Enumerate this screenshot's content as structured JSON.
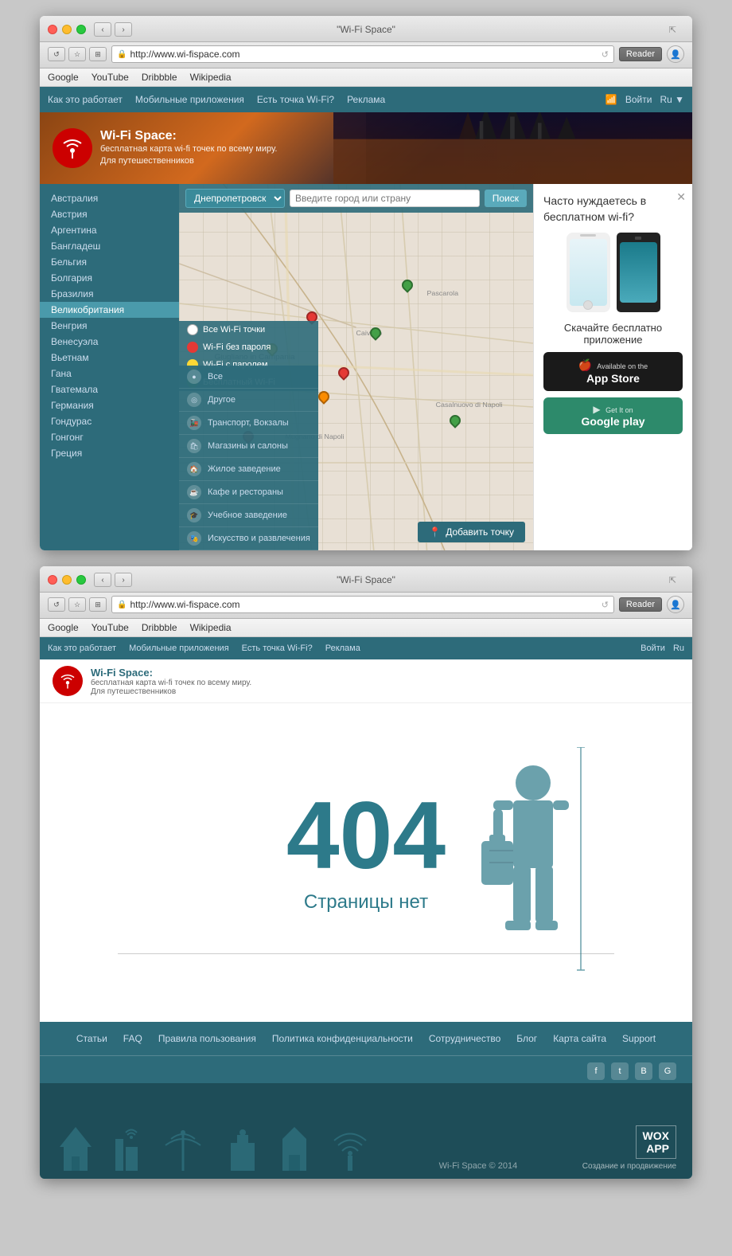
{
  "window1": {
    "title": "\"Wi-Fi Space\"",
    "url": "http://www.wi-fispace.com",
    "bookmarks": [
      "Google",
      "YouTube",
      "Dribbble",
      "Wikipedia"
    ],
    "reader_btn": "Reader"
  },
  "window2": {
    "title": "\"Wi-Fi Space\"",
    "url": "http://www.wi-fispace.com",
    "bookmarks": [
      "Google",
      "YouTube",
      "Dribbble",
      "Wikipedia"
    ],
    "reader_btn": "Reader"
  },
  "site": {
    "nav": {
      "items": [
        "Как это работает",
        "Мобильные приложения",
        "Есть точка Wi-Fi?",
        "Реклама"
      ],
      "login": "Войти",
      "lang": "Ru"
    },
    "hero": {
      "logo_title": "Wi-Fi Space:",
      "logo_sub1": "бесплатная карта wi-fi точек по всему миру.",
      "logo_sub2": "Для путешественников"
    },
    "countries": [
      "Австралия",
      "Австрия",
      "Аргентина",
      "Бангладеш",
      "Бельгия",
      "Болгария",
      "Бразилия",
      "Великобритания",
      "Венгрия",
      "Венесуэла",
      "Вьетнам",
      "Гана",
      "Гватемала",
      "Германия",
      "Гондурас",
      "Гонгонг",
      "Греция"
    ],
    "map": {
      "select_value": "Днепропетровск",
      "input_placeholder": "Введите город или страну",
      "search_btn": "Поиск",
      "add_point_btn": "Добавить точку"
    },
    "categories": [
      {
        "icon": "●",
        "label": "Все"
      },
      {
        "icon": "◎",
        "label": "Другое"
      },
      {
        "icon": "🚂",
        "label": "Транспорт, Вокзалы"
      },
      {
        "icon": "🛍",
        "label": "Магазины и салоны"
      },
      {
        "icon": "🏠",
        "label": "Жилое заведение"
      },
      {
        "icon": "☕",
        "label": "Кафе и рестораны"
      },
      {
        "icon": "🎓",
        "label": "Учебное заведение"
      },
      {
        "icon": "🎭",
        "label": "Искусство и развлечения"
      }
    ],
    "legend": [
      {
        "color": "#fff",
        "label": "Все Wi-Fi точки"
      },
      {
        "color": "#e53935",
        "label": "Wi-Fi без пароля"
      },
      {
        "color": "#fdd835",
        "label": "Wi-Fi с паролем"
      },
      {
        "color": "#43a047",
        "label": "Бесплатный Wi-Fi"
      }
    ],
    "ad": {
      "headline": "Часто нуждаетесь в бесплатном wi-fi?",
      "cta": "Скачайте бесплатно приложение",
      "appstore_sub": "Available on the",
      "appstore_name": "App Store",
      "googleplay_sub": "Get It on",
      "googleplay_name": "Google play"
    },
    "error": {
      "code": "404",
      "message": "Страницы нет"
    },
    "footer": {
      "links": [
        "Статьи",
        "FAQ",
        "Правила пользования",
        "Политика конфиденциальности",
        "Сотрудничество",
        "Блог",
        "Карта сайта",
        "Support"
      ],
      "social": [
        "f",
        "t",
        "B",
        "G"
      ],
      "copyright": "Wi-Fi Space © 2014",
      "brand_name": "WOX\nAPP",
      "brand_sub": "Создание и продвижение"
    }
  }
}
